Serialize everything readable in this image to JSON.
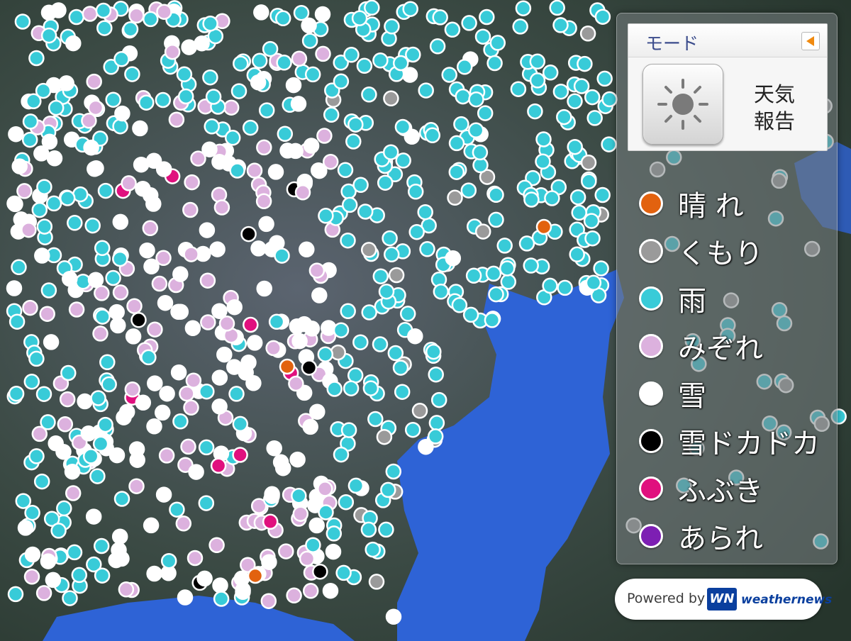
{
  "mode": {
    "title": "モード",
    "button_icon": "sun-cloud-icon",
    "selected_label": "天気報告"
  },
  "legend": [
    {
      "label": "晴 れ",
      "color": "#e2620f"
    },
    {
      "label": "くもり",
      "color": "#9a9a9a"
    },
    {
      "label": "雨",
      "color": "#38cbd8"
    },
    {
      "label": "みぞれ",
      "color": "#dcb1de"
    },
    {
      "label": "雪",
      "color": "#ffffff"
    },
    {
      "label": "雪ドカドカ",
      "color": "#000000"
    },
    {
      "label": "ふぶき",
      "color": "#e0107e"
    },
    {
      "label": "あられ",
      "color": "#7d1fb3"
    }
  ],
  "footer": {
    "powered_by": "Powered by",
    "logo_mark": "WN",
    "brand": "weathernews"
  },
  "colors": {
    "sea": "#2e63d6",
    "land": "#3a4a40"
  }
}
